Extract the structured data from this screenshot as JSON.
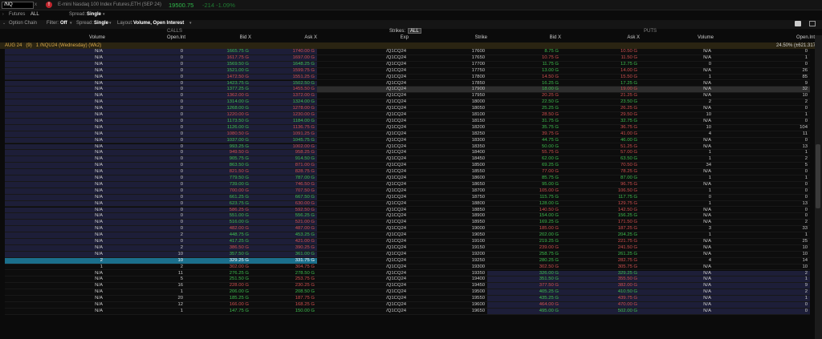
{
  "top": {
    "symbol": "/NQ",
    "close": "x",
    "alert": "!",
    "description": "E-mini Nasdaq 100 Index Futures,ETH (SEP 24)",
    "last": "19500.75",
    "change": "-214  -1.09%"
  },
  "futures": {
    "label": "Futures",
    "value": "ALL",
    "spread_label": "Spread:",
    "spread": "Single"
  },
  "option_chain": {
    "label": "Option Chain",
    "filter_label": "Filter:",
    "filter": "Off",
    "spread_label": "Spread:",
    "spread": "Single",
    "layout_label": "Layout:",
    "layout": "Volume, Open Interest"
  },
  "groups": {
    "calls": "CALLS",
    "puts": "PUTS",
    "strikes": "Strikes:",
    "strikes_value": "ALL"
  },
  "headers": {
    "volume": "Volume",
    "open_int": "Open.Int",
    "bid": "Bid X",
    "ask": "Ask X",
    "exp": "Exp",
    "strike": "Strike",
    "p_bid": "Bid X",
    "p_ask": "Ask X",
    "p_volume": "Volume",
    "p_open_int": "Open.Int"
  },
  "expiration": {
    "label": "AUG 24",
    "count": "(9)",
    "detail": "1 /NQU24 (Wednesday) (Wk2)",
    "iv": "24.50% (±621.317)"
  },
  "colors": {
    "calls_itm": "#1e1f3a",
    "puts_itm": "#1e1f3a",
    "highlight": "#1b6f8c",
    "green": "#3fbf4f",
    "red": "#d0504f"
  },
  "rows": [
    [
      "N/A",
      "0",
      "1665.75 G",
      "1740.00 G",
      "/Q1CQ24",
      "17600",
      "8.75 G",
      "10.50 G",
      "N/A",
      "0"
    ],
    [
      "N/A",
      "0",
      "1617.75 G",
      "1697.00 G",
      "/Q1CQ24",
      "17650",
      "10.75 G",
      "11.50 G",
      "N/A",
      "1"
    ],
    [
      "N/A",
      "0",
      "1569.50 G",
      "1648.25 G",
      "/Q1CQ24",
      "17700",
      "11.75 G",
      "12.75 G",
      "0",
      "0"
    ],
    [
      "N/A",
      "0",
      "1521.00 G",
      "1599.75 G",
      "/Q1CQ24",
      "17750",
      "13.00 G",
      "14.00 G",
      "N/A",
      "26"
    ],
    [
      "N/A",
      "0",
      "1472.50 G",
      "1551.25 G",
      "/Q1CQ24",
      "17800",
      "14.50 G",
      "15.50 G",
      "1",
      "85"
    ],
    [
      "N/A",
      "0",
      "1423.75 G",
      "1502.50 G",
      "/Q1CQ24",
      "17850",
      "16.25 G",
      "17.25 G",
      "N/A",
      "9"
    ],
    [
      "N/A",
      "0",
      "1377.25 G",
      "1455.50 G",
      "/Q1CQ24",
      "17900",
      "18.00 G",
      "19.00 G",
      "N/A",
      "32"
    ],
    [
      "N/A",
      "0",
      "1362.00 G",
      "1372.00 G",
      "/Q1CQ24",
      "17950",
      "20.25 G",
      "21.25 G",
      "N/A",
      "10"
    ],
    [
      "N/A",
      "0",
      "1314.00 G",
      "1324.00 G",
      "/Q1CQ24",
      "18000",
      "22.50 G",
      "23.50 G",
      "2",
      "2"
    ],
    [
      "N/A",
      "0",
      "1268.00 G",
      "1278.00 G",
      "/Q1CQ24",
      "18050",
      "25.25 G",
      "26.25 G",
      "N/A",
      "0"
    ],
    [
      "N/A",
      "0",
      "1220.00 G",
      "1230.00 G",
      "/Q1CQ24",
      "18100",
      "28.50 G",
      "29.50 G",
      "10",
      "1"
    ],
    [
      "N/A",
      "0",
      "1173.50 G",
      "1184.00 G",
      "/Q1CQ24",
      "18150",
      "31.75 G",
      "32.75 G",
      "N/A",
      "0"
    ],
    [
      "N/A",
      "0",
      "1126.00 G",
      "1136.75 G",
      "/Q1CQ24",
      "18200",
      "35.75 G",
      "36.75 G",
      "10",
      "104"
    ],
    [
      "N/A",
      "0",
      "1080.50 G",
      "1091.25 G",
      "/Q1CQ24",
      "18250",
      "39.75 G",
      "41.00 G",
      "4",
      "11"
    ],
    [
      "N/A",
      "0",
      "1037.00 G",
      "1045.75 G",
      "/Q1CQ24",
      "18300",
      "44.75 G",
      "46.00 G",
      "N/A",
      "0"
    ],
    [
      "N/A",
      "0",
      "993.25 G",
      "1002.00 G",
      "/Q1CQ24",
      "18350",
      "50.00 G",
      "51.25 G",
      "N/A",
      "13"
    ],
    [
      "N/A",
      "0",
      "949.50 G",
      "958.25 G",
      "/Q1CQ24",
      "18400",
      "55.75 G",
      "57.00 G",
      "1",
      "1"
    ],
    [
      "N/A",
      "0",
      "905.75 G",
      "914.50 G",
      "/Q1CQ24",
      "18450",
      "62.00 G",
      "63.50 G",
      "1",
      "2"
    ],
    [
      "N/A",
      "0",
      "863.50 G",
      "871.00 G",
      "/Q1CQ24",
      "18500",
      "69.25 G",
      "70.50 G",
      "34",
      "5"
    ],
    [
      "N/A",
      "0",
      "821.50 G",
      "828.75 G",
      "/Q1CQ24",
      "18550",
      "77.00 G",
      "78.25 G",
      "N/A",
      "0"
    ],
    [
      "N/A",
      "0",
      "779.50 G",
      "787.00 G",
      "/Q1CQ24",
      "18600",
      "85.75 G",
      "87.00 G",
      "1",
      "1"
    ],
    [
      "N/A",
      "0",
      "739.00 G",
      "746.50 G",
      "/Q1CQ24",
      "18650",
      "95.00 G",
      "96.75 G",
      "N/A",
      "0"
    ],
    [
      "N/A",
      "0",
      "700.00 G",
      "707.50 G",
      "/Q1CQ24",
      "18700",
      "105.00 G",
      "106.50 G",
      "1",
      "0"
    ],
    [
      "N/A",
      "0",
      "661.25 G",
      "667.50 G",
      "/Q1CQ24",
      "18750",
      "115.75 G",
      "117.75 G",
      "0",
      "0"
    ],
    [
      "N/A",
      "0",
      "623.75 G",
      "630.00 G",
      "/Q1CQ24",
      "18800",
      "128.00 G",
      "129.75 G",
      "1",
      "13"
    ],
    [
      "N/A",
      "0",
      "586.25 G",
      "592.50 G",
      "/Q1CQ24",
      "18850",
      "140.50 G",
      "142.50 G",
      "N/A",
      "0"
    ],
    [
      "N/A",
      "0",
      "551.00 G",
      "556.25 G",
      "/Q1CQ24",
      "18900",
      "154.00 G",
      "156.25 G",
      "N/A",
      "0"
    ],
    [
      "N/A",
      "0",
      "516.00 G",
      "521.00 G",
      "/Q1CQ24",
      "18950",
      "169.25 G",
      "171.50 G",
      "N/A",
      "2"
    ],
    [
      "N/A",
      "0",
      "482.00 G",
      "487.00 G",
      "/Q1CQ24",
      "19000",
      "185.00 G",
      "187.25 G",
      "3",
      "33"
    ],
    [
      "N/A",
      "2",
      "448.75 G",
      "453.25 G",
      "/Q1CQ24",
      "19050",
      "202.00 G",
      "204.25 G",
      "1",
      "1"
    ],
    [
      "N/A",
      "0",
      "417.25 G",
      "421.00 G",
      "/Q1CQ24",
      "19100",
      "219.25 G",
      "221.75 G",
      "N/A",
      "25"
    ],
    [
      "N/A",
      "2",
      "386.50 G",
      "390.25 G",
      "/Q1CQ24",
      "19150",
      "239.00 G",
      "241.50 G",
      "N/A",
      "10"
    ],
    [
      "N/A",
      "10",
      "357.50 G",
      "361.00 G",
      "/Q1CQ24",
      "19200",
      "258.75 G",
      "261.25 G",
      "N/A",
      "10"
    ],
    [
      "2",
      "10",
      "329.25 G",
      "331.75 G",
      "/Q1CQ24",
      "19250",
      "280.25 G",
      "282.75 G",
      "4",
      "14"
    ],
    [
      "1",
      "2",
      "302.00 G",
      "304.75 G",
      "/Q1CQ24",
      "19300",
      "302.50 G",
      "305.75 G",
      "N/A",
      "10"
    ],
    [
      "N/A",
      "11",
      "276.25 G",
      "278.50 G",
      "/Q1CQ24",
      "19350",
      "326.00 G",
      "329.25 G",
      "N/A",
      "2"
    ],
    [
      "N/A",
      "5",
      "251.50 G",
      "253.75 G",
      "/Q1CQ24",
      "19400",
      "351.50 G",
      "355.50 G",
      "N/A",
      "1"
    ],
    [
      "N/A",
      "16",
      "228.00 G",
      "230.25 G",
      "/Q1CQ24",
      "19450",
      "377.50 G",
      "382.00 G",
      "N/A",
      "9"
    ],
    [
      "N/A",
      "1",
      "206.00 G",
      "208.50 G",
      "/Q1CQ24",
      "19500",
      "405.25 G",
      "410.50 G",
      "N/A",
      "2"
    ],
    [
      "N/A",
      "20",
      "185.25 G",
      "187.75 G",
      "/Q1CQ24",
      "19550",
      "435.25 G",
      "439.75 G",
      "N/A",
      "1"
    ],
    [
      "N/A",
      "12",
      "166.00 G",
      "168.25 G",
      "/Q1CQ24",
      "19600",
      "464.00 G",
      "470.00 G",
      "N/A",
      "0"
    ],
    [
      "N/A",
      "1",
      "147.75 G",
      "150.00 G",
      "/Q1CQ24",
      "19650",
      "495.00 G",
      "502.00 G",
      "N/A",
      "0"
    ]
  ]
}
